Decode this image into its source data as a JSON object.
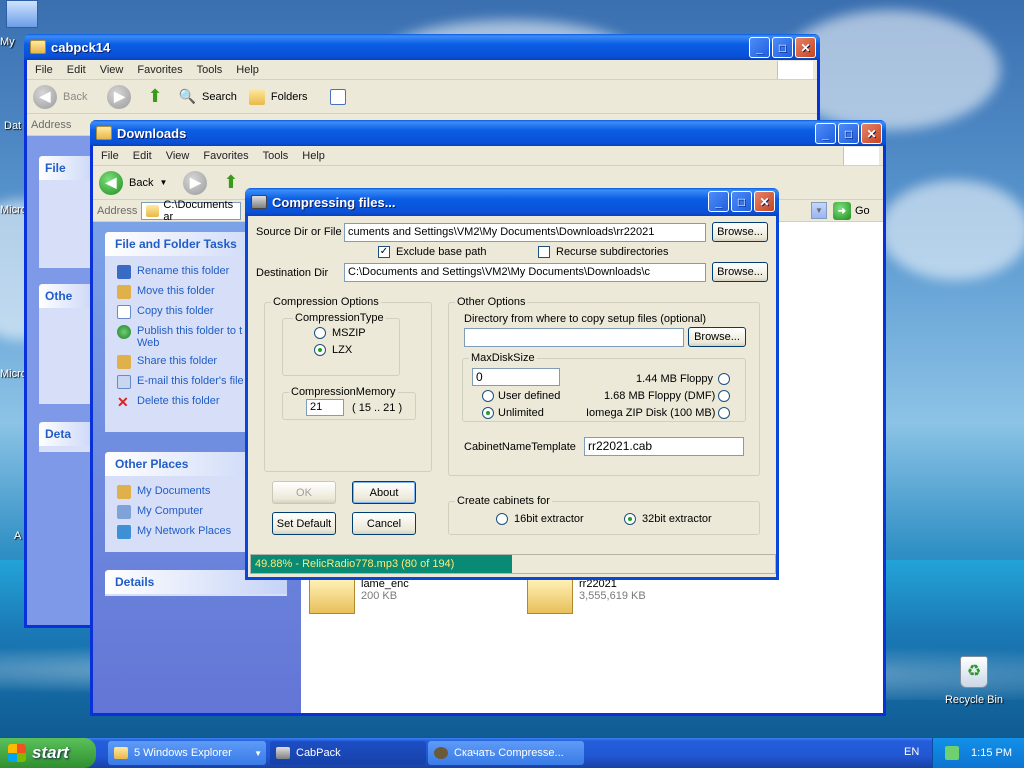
{
  "desktop": {
    "icons": [
      {
        "label": "My"
      },
      {
        "label": "Dat"
      },
      {
        "label": "Micro"
      },
      {
        "label": "Micro"
      },
      {
        "label": "A"
      },
      {
        "label": "Recycle Bin"
      }
    ]
  },
  "window_back": {
    "title": "cabpck14",
    "menu": [
      "File",
      "Edit",
      "View",
      "Favorites",
      "Tools",
      "Help"
    ],
    "toolbar": {
      "back": "Back",
      "search": "Search",
      "folders": "Folders"
    },
    "address_label": "Address",
    "panel_labels": [
      "File",
      "Othe",
      "Deta"
    ]
  },
  "window_downloads": {
    "title": "Downloads",
    "menu": [
      "File",
      "Edit",
      "View",
      "Favorites",
      "Tools",
      "Help"
    ],
    "toolbar": {
      "back": "Back"
    },
    "address_label": "Address",
    "address_value": "C:\\Documents ar",
    "go": "Go",
    "tasks_title": "File and Folder Tasks",
    "tasks": [
      "Rename this folder",
      "Move this folder",
      "Copy this folder",
      "Publish this folder to t Web",
      "Share this folder",
      "E-mail this folder's file",
      "Delete this folder"
    ],
    "other_title": "Other Places",
    "other": [
      "My Documents",
      "My Computer",
      "My Network Places"
    ],
    "details_title": "Details",
    "files": [
      {
        "name": "lame_enc",
        "size": "200 KB"
      },
      {
        "name": "rr22021",
        "size": "3,555,619 KB"
      }
    ]
  },
  "dialog": {
    "title": "Compressing files...",
    "source_label": "Source Dir or File",
    "source_value": "cuments and Settings\\VM2\\My Documents\\Downloads\\rr22021",
    "browse": "Browse...",
    "exclude_base": "Exclude base path",
    "recurse": "Recurse subdirectories",
    "dest_label": "Destination Dir",
    "dest_value": "C:\\Documents and Settings\\VM2\\My Documents\\Downloads\\c",
    "compression_options": "Compression Options",
    "compression_type": "CompressionType",
    "mszip": "MSZIP",
    "lzx": "LZX",
    "compression_memory": "CompressionMemory",
    "memory_value": "21",
    "memory_range": "( 15 .. 21 )",
    "other_options": "Other Options",
    "setup_dir_label": "Directory from where to copy setup files (optional)",
    "setup_dir_value": "",
    "maxdisk": "MaxDiskSize",
    "maxdisk_value": "0",
    "user_defined": "User defined",
    "unlimited": "Unlimited",
    "floppy144": "1.44 MB Floppy",
    "floppy168": "1.68 MB Floppy (DMF)",
    "zip100": "Iomega ZIP Disk (100 MB)",
    "cab_template_label": "CabinetNameTemplate",
    "cab_template_value": "rr22021.cab",
    "ok": "OK",
    "about": "About",
    "set_default": "Set Default",
    "cancel": "Cancel",
    "create_cabinets": "Create cabinets for",
    "bit16": "16bit extractor",
    "bit32": "32bit extractor",
    "progress_text": "49.88% - RelicRadio778.mp3 (80 of 194)",
    "progress_value": 0.4988
  },
  "taskbar": {
    "start": "start",
    "items": [
      {
        "label": "5 Windows Explorer"
      },
      {
        "label": "CabPack"
      },
      {
        "label": "Скачать Compresse..."
      }
    ],
    "lang": "EN",
    "time": "1:15 PM"
  },
  "colors": {
    "xp_blue": "#0a5ae0",
    "progress": "#088a74",
    "link": "#215dc6"
  }
}
